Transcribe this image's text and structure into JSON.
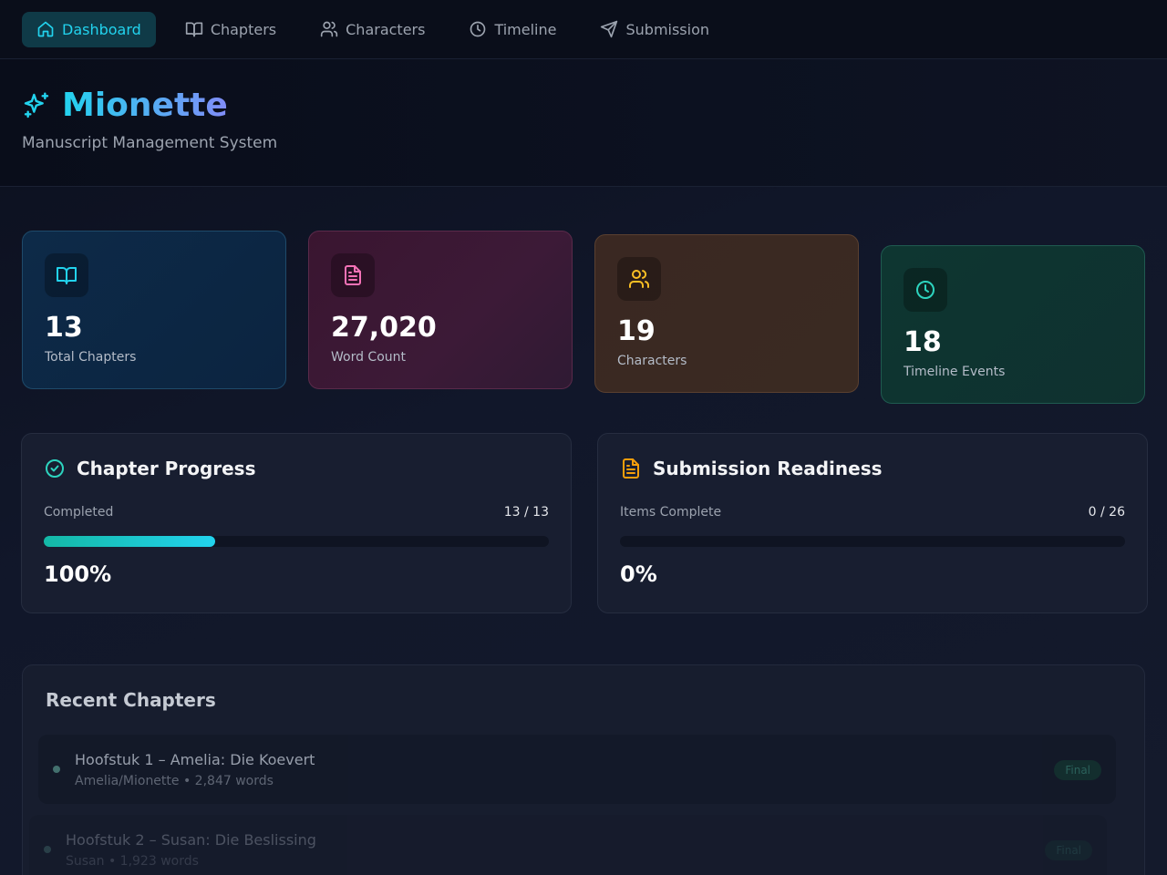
{
  "nav": {
    "items": [
      {
        "label": "Dashboard",
        "active": true,
        "icon": "home-icon"
      },
      {
        "label": "Chapters",
        "active": false,
        "icon": "book-open-icon"
      },
      {
        "label": "Characters",
        "active": false,
        "icon": "users-icon"
      },
      {
        "label": "Timeline",
        "active": false,
        "icon": "clock-icon"
      },
      {
        "label": "Submission",
        "active": false,
        "icon": "send-icon"
      }
    ]
  },
  "header": {
    "title": "Mionette",
    "subtitle": "Manuscript Management System",
    "icon": "sparkles-icon"
  },
  "stats": [
    {
      "value": "13",
      "label": "Total Chapters",
      "icon": "book-open-icon",
      "color": "#22d3ee"
    },
    {
      "value": "27,020",
      "label": "Word Count",
      "icon": "file-text-icon",
      "color": "#f472b6"
    },
    {
      "value": "19",
      "label": "Characters",
      "icon": "users-icon",
      "color": "#fbbf24"
    },
    {
      "value": "18",
      "label": "Timeline Events",
      "icon": "clock-icon",
      "color": "#2dd4bf"
    }
  ],
  "chapter_progress": {
    "title": "Chapter Progress",
    "label": "Completed",
    "count": "13 / 13",
    "percent_text": "100%",
    "bar_fraction": 0.34,
    "icon": "check-circle-icon"
  },
  "submission_readiness": {
    "title": "Submission Readiness",
    "label": "Items Complete",
    "count": "0 / 26",
    "percent_text": "0%",
    "bar_fraction": 0,
    "icon": "file-text-icon"
  },
  "recent": {
    "title": "Recent Chapters",
    "chapters": [
      {
        "title": "Hoofstuk 1 – Amelia: Die Koevert",
        "meta": "Amelia/Mionette • 2,847 words",
        "status": "Final"
      },
      {
        "title": "Hoofstuk 2 – Susan: Die Beslissing",
        "meta": "Susan • 1,923 words",
        "status": "Final"
      }
    ]
  },
  "colors": {
    "accent": "#22d3ee",
    "accent_bg": "#0f3a47",
    "progress": "#14b8a6",
    "submission_icon": "#f59e0b"
  }
}
